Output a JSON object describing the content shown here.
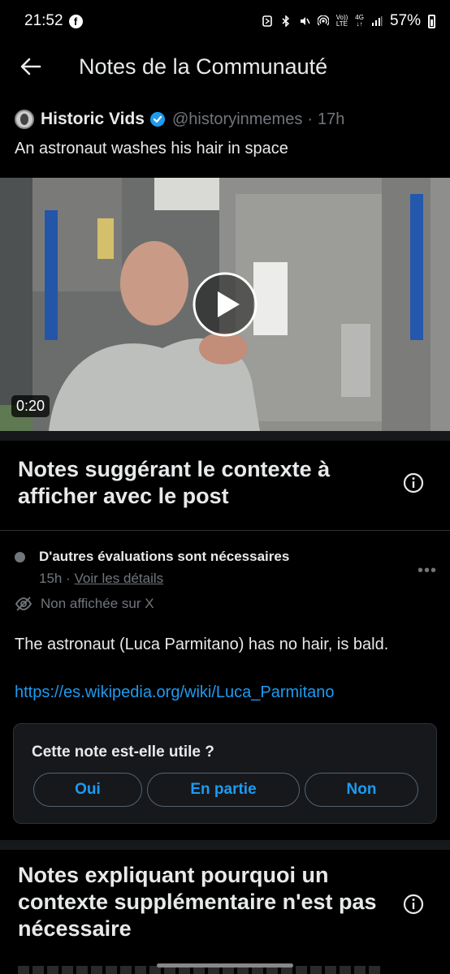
{
  "status_bar": {
    "time": "21:52",
    "facebook_icon": "f",
    "network_lte": "LTE",
    "network_4g": "4G",
    "volte": "Vo))",
    "battery": "57%"
  },
  "header": {
    "title": "Notes de la Communauté"
  },
  "tweet": {
    "author": "Historic Vids",
    "handle": "@historyinmemes",
    "separator": "·",
    "time": "17h",
    "text": "An astronaut washes his hair in space",
    "video_duration": "0:20"
  },
  "section_suggesting": {
    "title": "Notes suggérant le contexte à afficher avec le post"
  },
  "note": {
    "status": "D'autres évaluations sont nécessaires",
    "time": "15h",
    "separator": "·",
    "details_link": "Voir les détails",
    "visibility": "Non affichée sur X",
    "body": "The astronaut (Luca Parmitano) has no hair, is bald.",
    "link": "https://es.wikipedia.org/wiki/Luca_Parmitano",
    "more_menu": "•••"
  },
  "rating": {
    "question": "Cette note est-elle utile ?",
    "buttons": [
      "Oui",
      "En partie",
      "Non"
    ]
  },
  "section_not_needed": {
    "title": "Notes expliquant pourquoi un contexte supplémentaire n'est pas nécessaire"
  },
  "colors": {
    "background": "#000000",
    "text": "#e7e9ea",
    "muted": "#71767b",
    "accent": "#1d9bf0",
    "panel": "#16181c"
  }
}
